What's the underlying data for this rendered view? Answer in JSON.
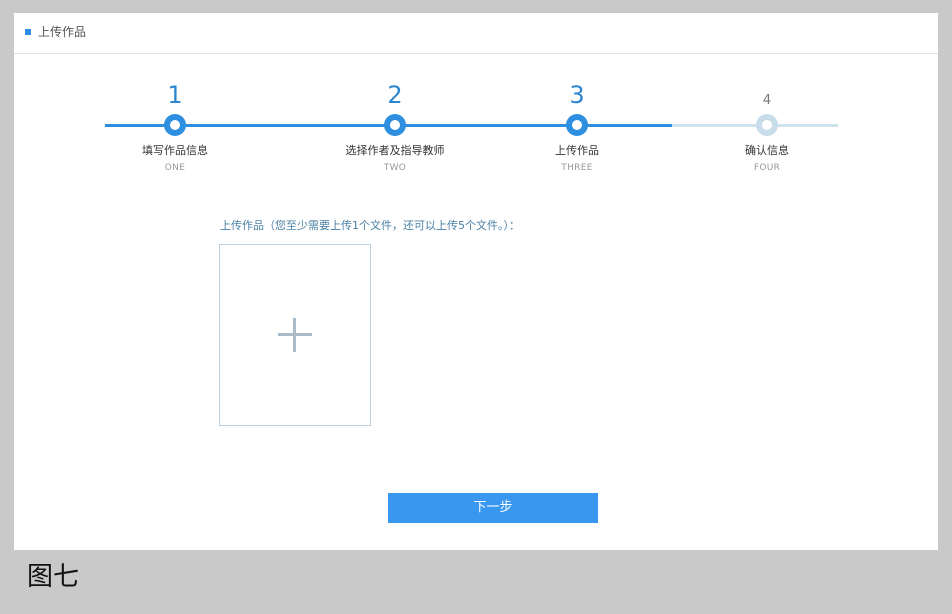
{
  "header": {
    "title": "上传作品"
  },
  "steps": [
    {
      "number": "1",
      "label": "填写作品信息",
      "sub": "ONE",
      "state": "done"
    },
    {
      "number": "2",
      "label": "选择作者及指导教师",
      "sub": "TWO",
      "state": "done"
    },
    {
      "number": "3",
      "label": "上传作品",
      "sub": "THREE",
      "state": "current"
    },
    {
      "number": "4",
      "label": "确认信息",
      "sub": "FOUR",
      "state": "pending"
    }
  ],
  "upload": {
    "hint": "上传作品（您至少需要上传1个文件，还可以上传5个文件。）：",
    "add_icon": "plus-icon"
  },
  "actions": {
    "next_label": "下一步"
  },
  "caption": "图七",
  "colors": {
    "accent": "#2e8fe0",
    "button": "#3a97f0",
    "pending": "#c7dde9"
  }
}
